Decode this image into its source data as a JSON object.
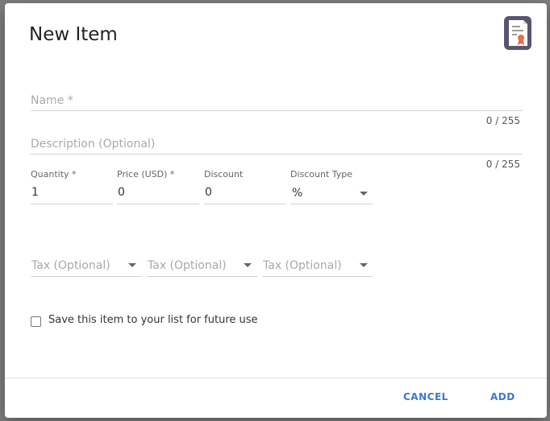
{
  "dialog": {
    "title": "New Item",
    "icon": "certificate-document-icon"
  },
  "form": {
    "name": {
      "placeholder": "Name *",
      "counter": "0 / 255"
    },
    "description": {
      "placeholder": "Description (Optional)",
      "counter": "0 / 255"
    },
    "quantity": {
      "label": "Quantity *",
      "value": "1"
    },
    "price": {
      "label": "Price (USD) *",
      "value": "0"
    },
    "discount": {
      "label": "Discount",
      "value": "0"
    },
    "discount_type": {
      "label": "Discount Type",
      "value": "%"
    },
    "taxes": [
      {
        "placeholder": "Tax (Optional)"
      },
      {
        "placeholder": "Tax (Optional)"
      },
      {
        "placeholder": "Tax (Optional)"
      }
    ],
    "save_checkbox": {
      "label": "Save this item to your list for future use",
      "checked": false
    }
  },
  "actions": {
    "cancel": "CANCEL",
    "add": "ADD"
  },
  "colors": {
    "accent": "#3d78c9",
    "icon_frame": "#5b5470",
    "icon_ribbon": "#e2724f"
  }
}
